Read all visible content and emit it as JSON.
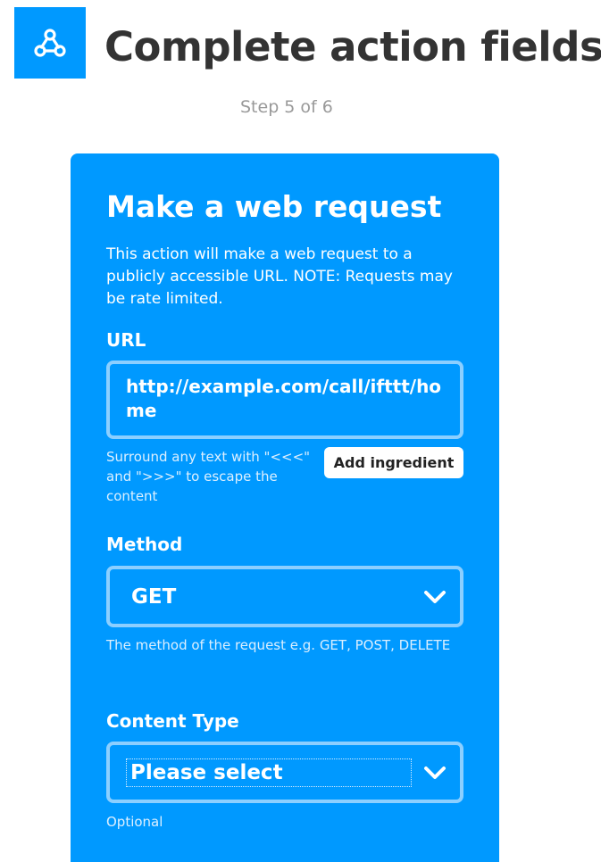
{
  "header": {
    "title": "Complete action fields",
    "step": "Step 5 of 6"
  },
  "service": {
    "icon": "webhooks-icon",
    "color": "#0099ff"
  },
  "card": {
    "title": "Make a web request",
    "description": "This action will make a web request to a publicly accessible URL. NOTE: Requests may be rate limited.",
    "url": {
      "label": "URL",
      "value": "http://example.com/call/ifttt/home",
      "helper": "Surround any text with \"<<<\" and \">>>\" to escape the content",
      "add_ingredient": "Add ingredient"
    },
    "method": {
      "label": "Method",
      "value": "GET",
      "helper": "The method of the request e.g. GET, POST, DELETE"
    },
    "content_type": {
      "label": "Content Type",
      "value": "Please select",
      "helper": "Optional"
    }
  }
}
